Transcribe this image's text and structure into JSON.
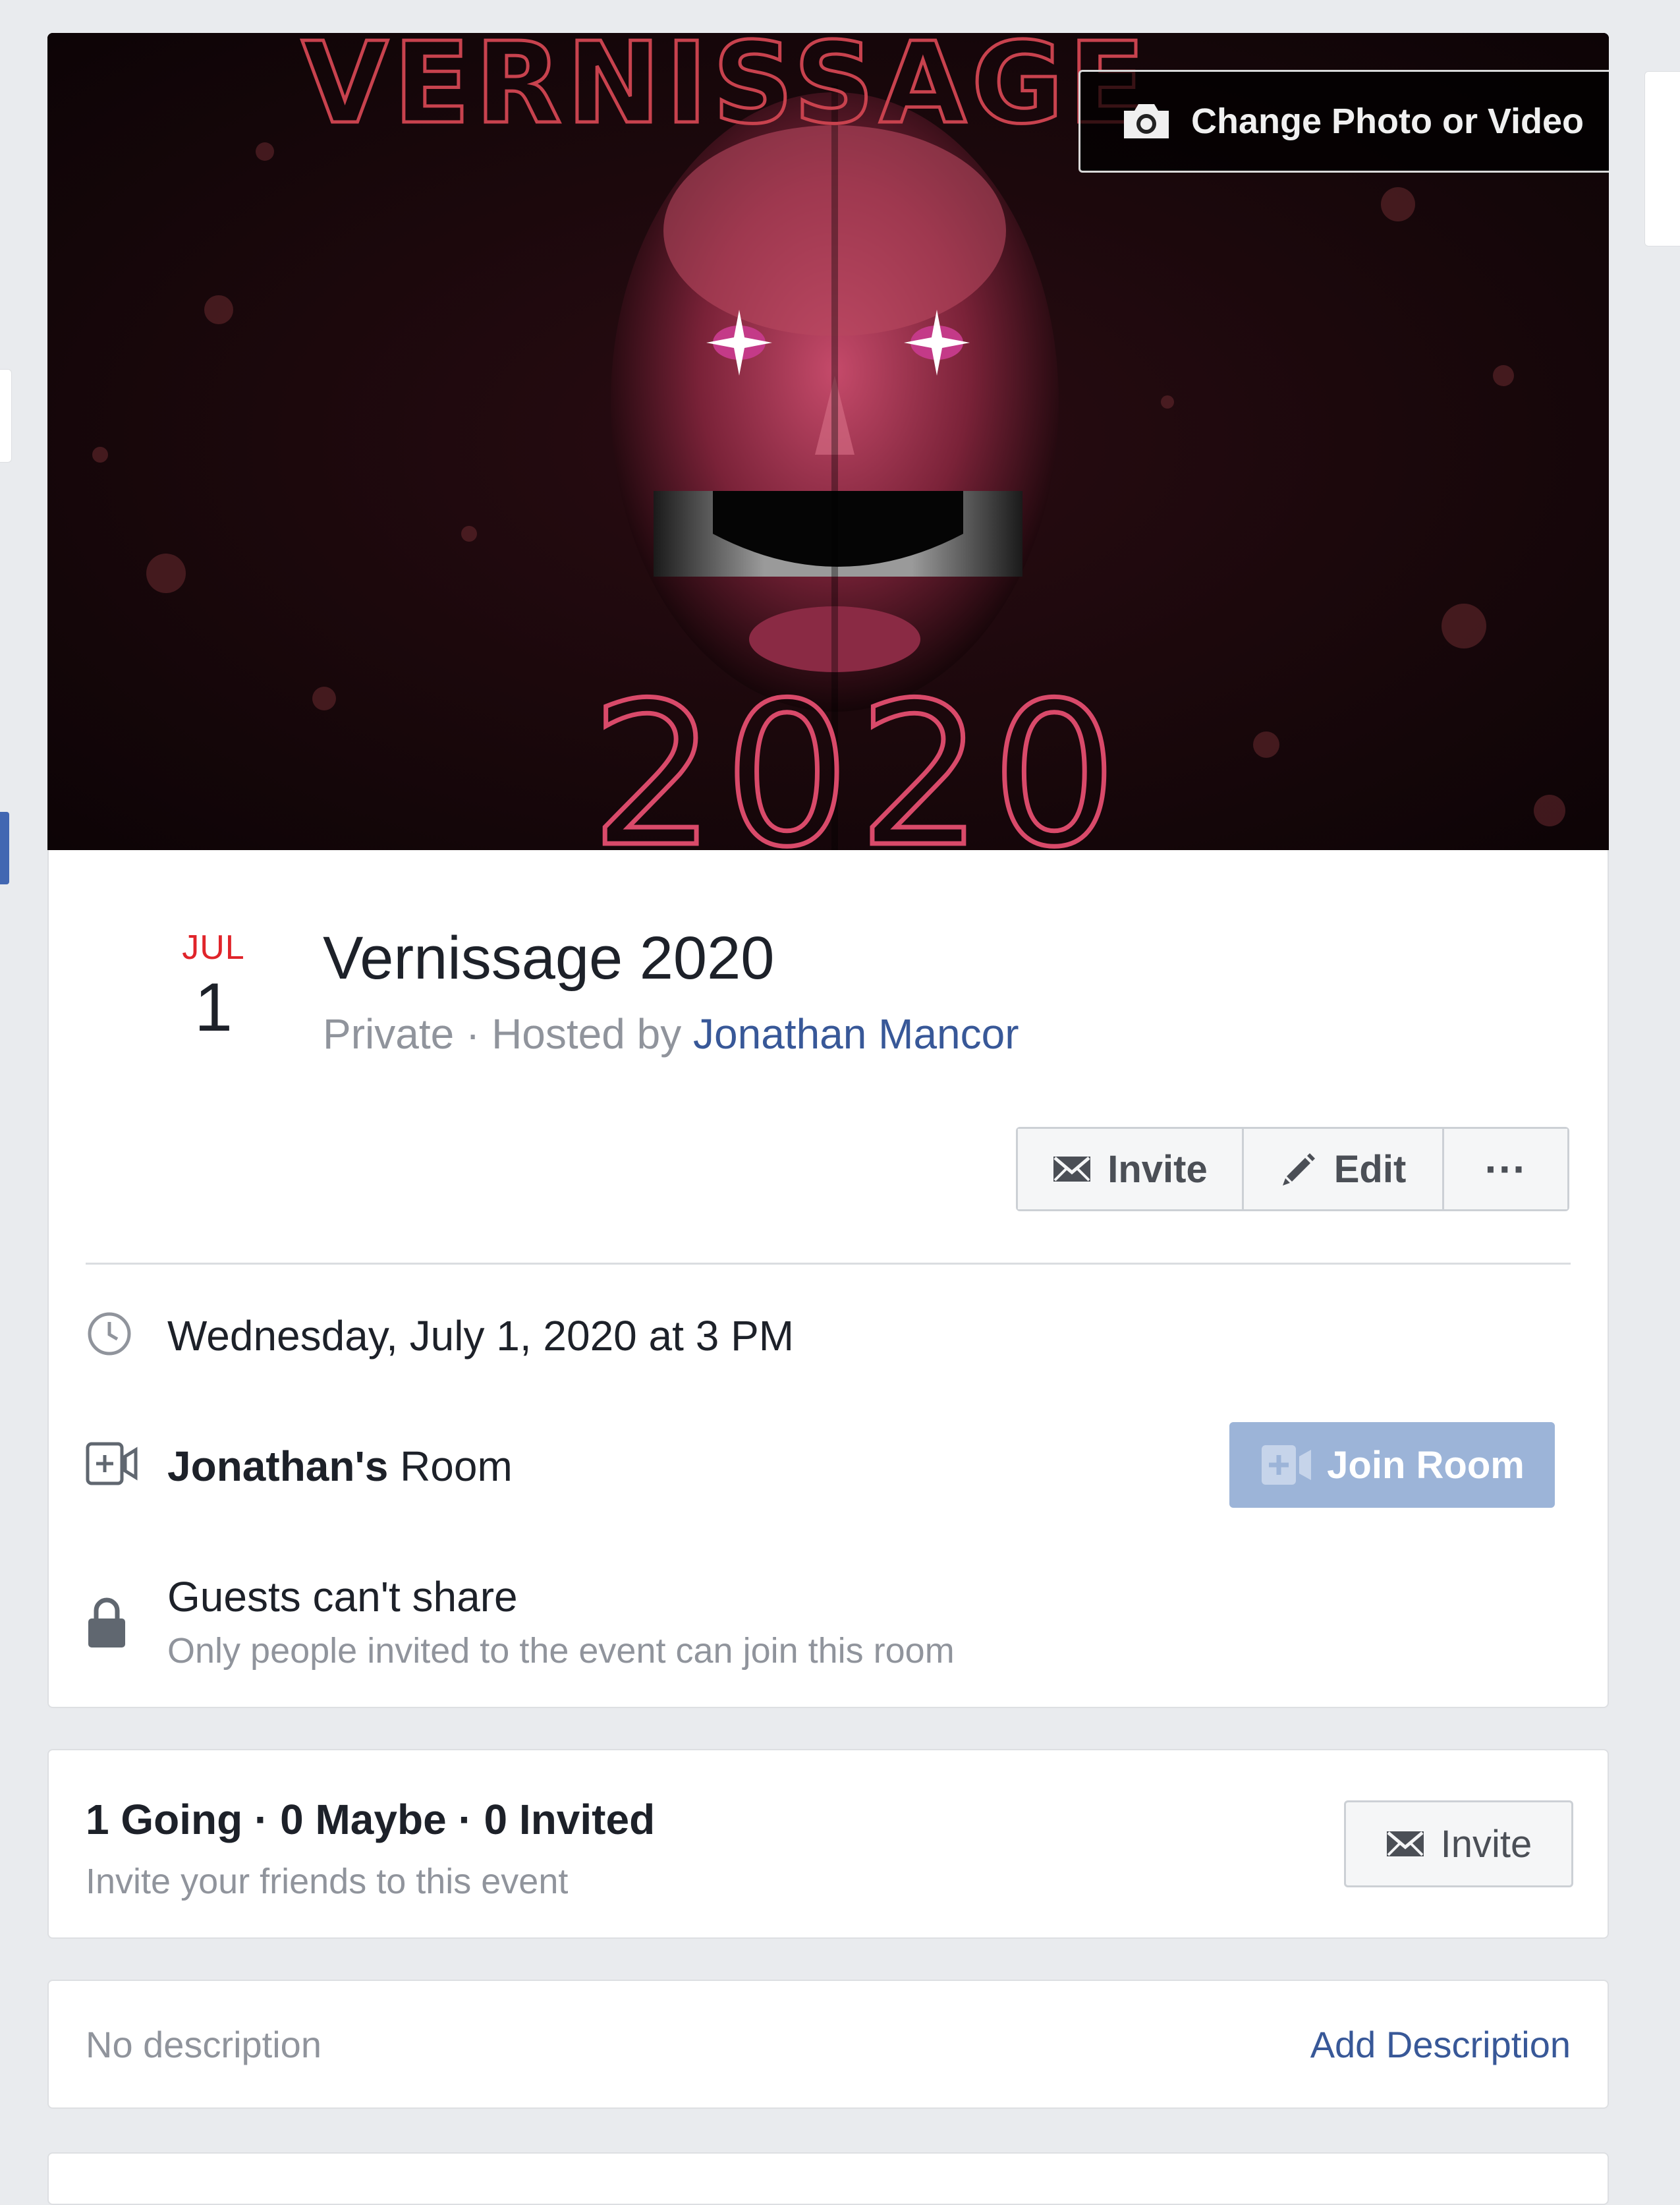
{
  "cover": {
    "title_art": "VERNISSAGE",
    "year_art": "2020",
    "change_button_label": "Change Photo or Video"
  },
  "event": {
    "month": "JUL",
    "day": "1",
    "title": "Vernissage 2020",
    "privacy": "Private",
    "hosted_by_prefix": " · Hosted by ",
    "host": "Jonathan Mancor"
  },
  "actions": {
    "invite_label": "Invite",
    "edit_label": "Edit",
    "more_label": "···"
  },
  "info": {
    "datetime": "Wednesday, July 1, 2020 at 3 PM",
    "room_owner": "Jonathan's",
    "room_suffix": " Room",
    "join_label": "Join Room",
    "share_title": "Guests can't share",
    "share_sub": "Only people invited to the event can join this room"
  },
  "guests": {
    "counts": "1 Going · 0 Maybe · 0 Invited",
    "hint": "Invite your friends to this event",
    "invite_label": "Invite"
  },
  "description": {
    "empty_text": "No description",
    "add_label": "Add Description"
  },
  "colors": {
    "link": "#385898",
    "month": "#e0242a",
    "join_disabled": "#9cb4d8",
    "cover_pink": "#d94a6a"
  }
}
